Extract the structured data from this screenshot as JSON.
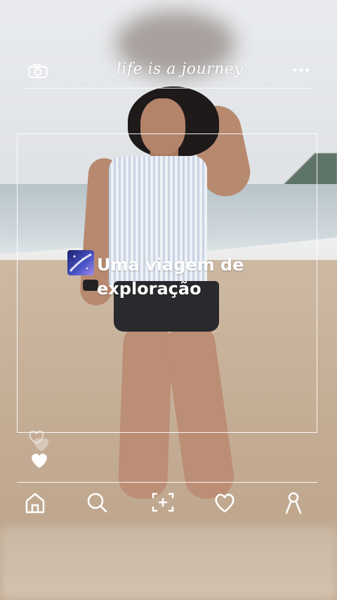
{
  "header": {
    "title": "life is a journey",
    "left_icon": "camera-icon",
    "right_icon": "more-dots-icon"
  },
  "caption": {
    "icon": "galaxy-emoji-icon",
    "line1": "Uma viagem de",
    "line2": "exploração"
  },
  "side": {
    "icon": "hearts-icon"
  },
  "bottom_nav": [
    {
      "name": "home",
      "icon": "home-icon"
    },
    {
      "name": "search",
      "icon": "search-icon"
    },
    {
      "name": "add",
      "icon": "add-post-icon"
    },
    {
      "name": "likes",
      "icon": "heart-icon"
    },
    {
      "name": "profile",
      "icon": "profile-icon"
    }
  ],
  "colors": {
    "overlay": "#ffffff",
    "sand": "#c4ac94",
    "sea": "#cfd8dc"
  }
}
